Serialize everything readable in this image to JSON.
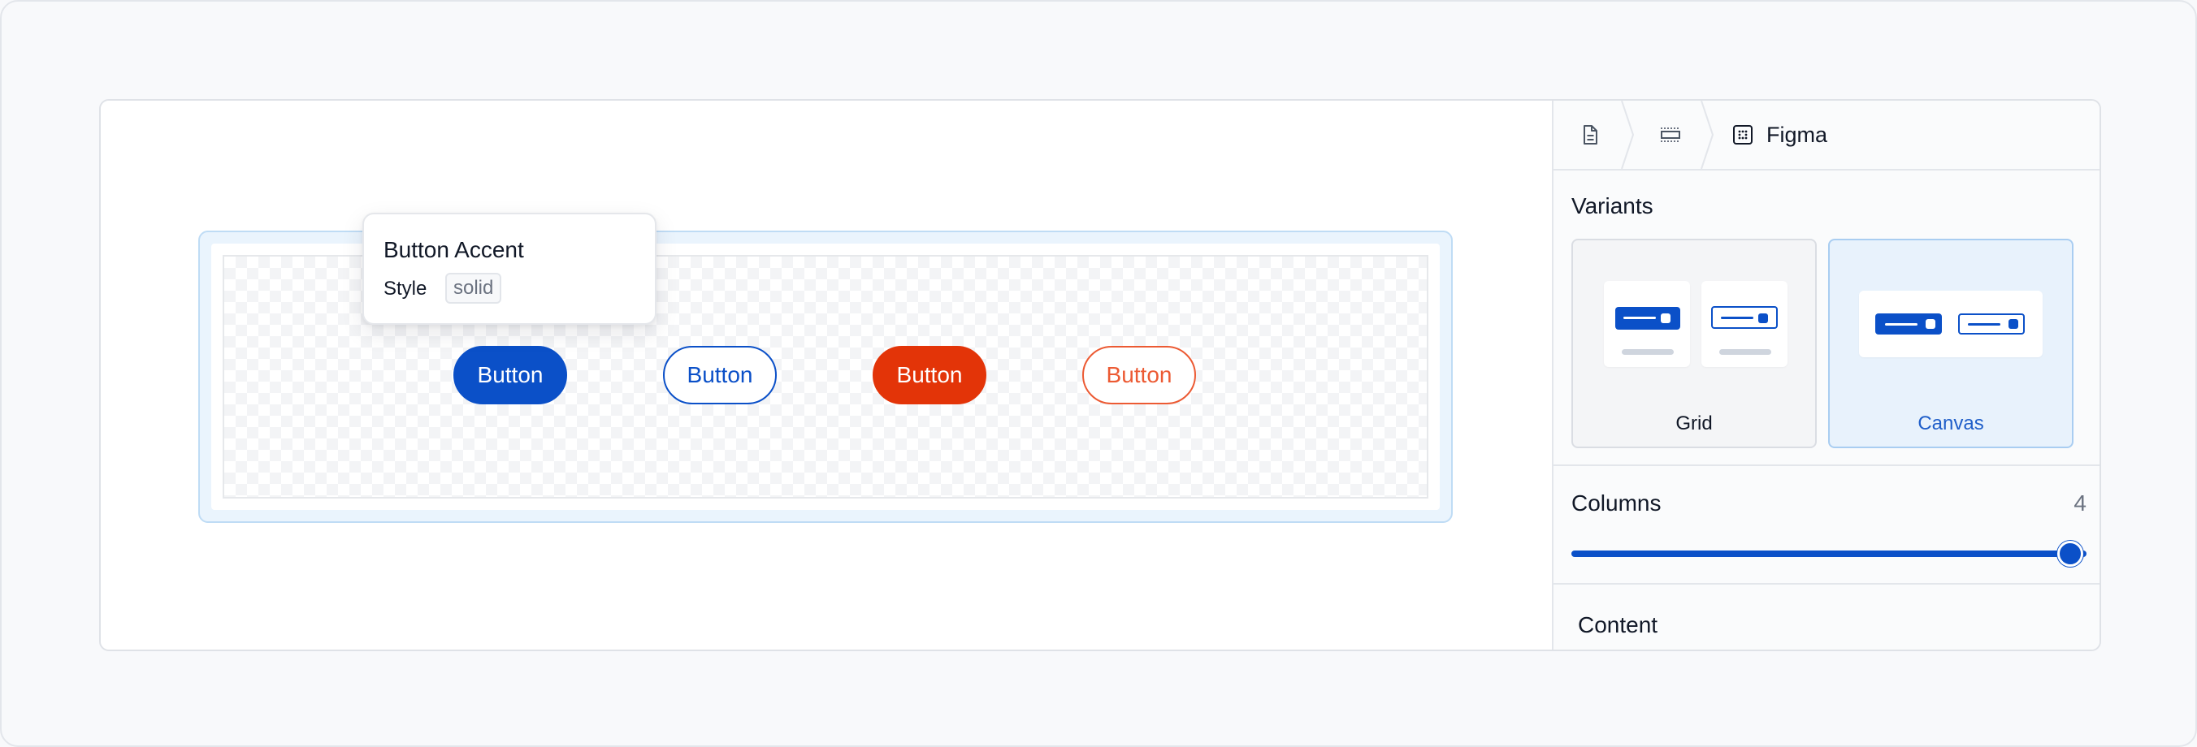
{
  "canvas": {
    "tooltip": {
      "title": "Button Accent",
      "property_label": "Style",
      "property_value": "solid"
    },
    "buttons": [
      {
        "label": "Button"
      },
      {
        "label": "Button"
      },
      {
        "label": "Button"
      },
      {
        "label": "Button"
      }
    ]
  },
  "panel": {
    "breadcrumb": {
      "items": [
        {
          "icon": "document-icon"
        },
        {
          "icon": "frame-icon"
        },
        {
          "icon": "figma-grid-icon",
          "label": "Figma"
        }
      ]
    },
    "variants": {
      "title": "Variants",
      "options": [
        {
          "label": "Grid",
          "active": false
        },
        {
          "label": "Canvas",
          "active": true
        }
      ]
    },
    "columns": {
      "title": "Columns",
      "value": "4",
      "slider_fraction": 1.0
    },
    "content": {
      "title": "Content"
    }
  },
  "colors": {
    "accent": "#0b50c8",
    "danger": "#e33408",
    "danger_outline": "#ec5a33",
    "selection": "#bfdcf5",
    "active_variant_bg": "#e8f2fc"
  }
}
